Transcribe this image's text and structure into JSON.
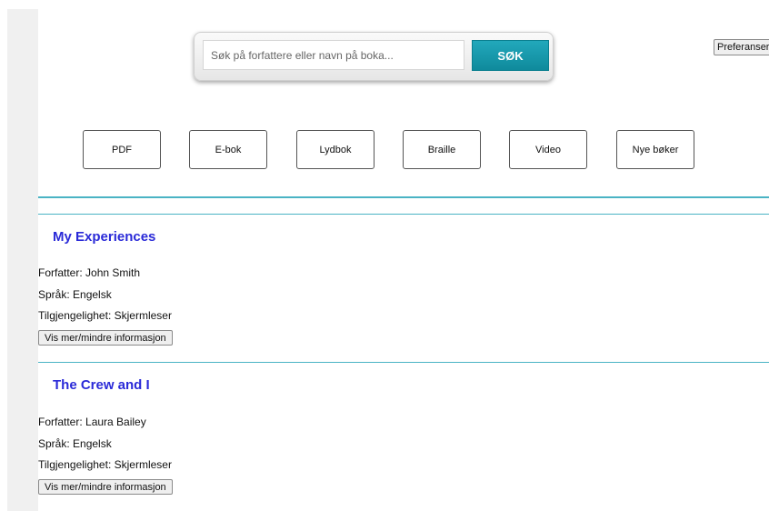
{
  "search": {
    "placeholder": "Søk på forfattere eller navn på boka...",
    "value": "",
    "button_label": "SØK"
  },
  "preferences": {
    "label": "Preferanser"
  },
  "filters": [
    {
      "label": "PDF"
    },
    {
      "label": "E-bok"
    },
    {
      "label": "Lydbok"
    },
    {
      "label": "Braille"
    },
    {
      "label": "Video"
    },
    {
      "label": "Nye bøker"
    }
  ],
  "books": [
    {
      "title": "My Experiences",
      "author": "Forfatter: John Smith",
      "language": "Språk: Engelsk",
      "accessibility": "Tilgjengelighet: Skjermleser",
      "toggle_label": "Vis mer/mindre informasjon"
    },
    {
      "title": "The Crew and I",
      "author": "Forfatter: Laura Bailey",
      "language": "Språk: Engelsk",
      "accessibility": "Tilgjengelighet: Skjermleser",
      "toggle_label": "Vis mer/mindre informasjon"
    }
  ],
  "colors": {
    "accent": "#0f8a9c",
    "title": "#2a2ad8",
    "divider": "#4ab3c4"
  }
}
